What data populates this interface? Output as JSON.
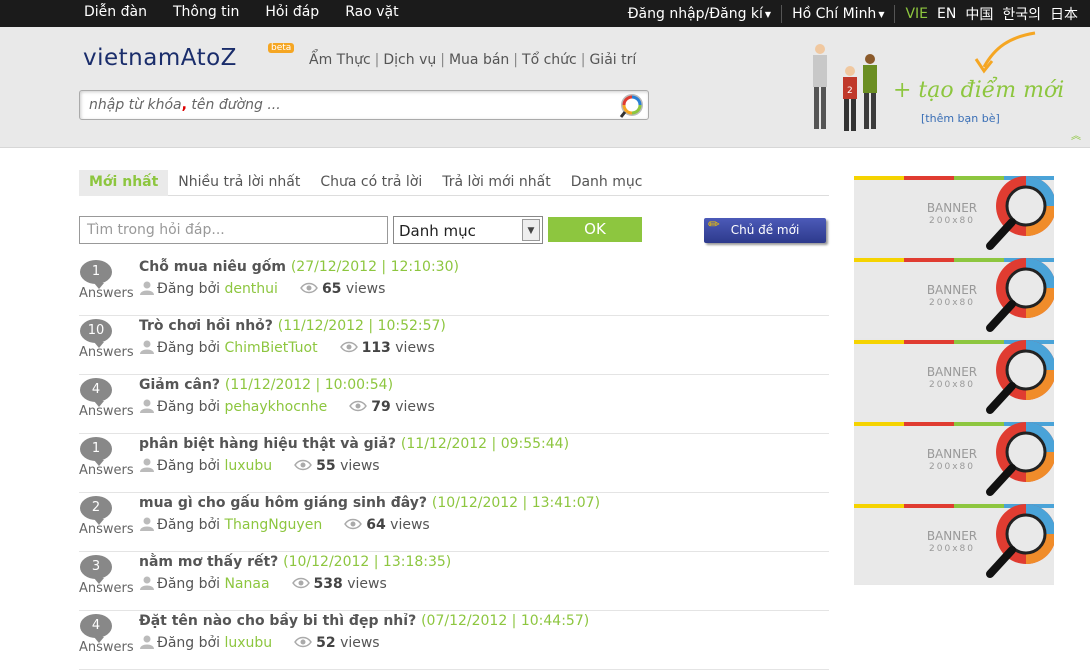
{
  "topbar": {
    "nav": [
      "Diễn đàn",
      "Thông tin",
      "Hỏi đáp",
      "Rao vặt"
    ],
    "login": "Đăng nhập/Đăng kí",
    "city": "Hồ Chí Minh",
    "languages": {
      "active": "VIE",
      "others": [
        "EN",
        "中国",
        "한국의",
        "日本"
      ]
    }
  },
  "header": {
    "logo": "vietnamAtoZ",
    "logo_badge": "beta",
    "categories": [
      "Ẩm Thực",
      "Dịch vụ",
      "Mua bán",
      "Tổ chức",
      "Giải trí"
    ],
    "search_placeholder_a": "nhập từ khóa",
    "search_placeholder_comma": ",",
    "search_placeholder_b": " tên đường ...",
    "add_place": "+ tạo điểm mới",
    "add_friend": "[thêm bạn bè]"
  },
  "tabs": [
    "Mới nhất",
    "Nhiều trả lời nhất",
    "Chưa có trả lời",
    "Trả lời mới nhất",
    "Danh mục"
  ],
  "filter": {
    "search_placeholder": "Tìm trong hỏi đáp...",
    "category_select": "Danh mục",
    "ok_label": "OK",
    "new_topic_label": "Chủ đề mới"
  },
  "questions": [
    {
      "answers": "1",
      "answers_label": "Answers",
      "title": "Chỗ mua niêu gốm",
      "date": "(27/12/2012 | 12:10:30)",
      "posted_by": "Đăng bởi",
      "author": "denthui",
      "views": "65",
      "views_label": "views"
    },
    {
      "answers": "10",
      "answers_label": "Answers",
      "title": "Trò chơi hồi nhỏ?",
      "date": "(11/12/2012 | 10:52:57)",
      "posted_by": "Đăng bởi",
      "author": "ChimBietTuot",
      "views": "113",
      "views_label": "views"
    },
    {
      "answers": "4",
      "answers_label": "Answers",
      "title": "Giảm cân?",
      "date": "(11/12/2012 | 10:00:54)",
      "posted_by": "Đăng bởi",
      "author": "pehaykhocnhe",
      "views": "79",
      "views_label": "views"
    },
    {
      "answers": "1",
      "answers_label": "Answers",
      "title": "phân biệt hàng hiệu thật và giả?",
      "date": "(11/12/2012 | 09:55:44)",
      "posted_by": "Đăng bởi",
      "author": "luxubu",
      "views": "55",
      "views_label": "views"
    },
    {
      "answers": "2",
      "answers_label": "Answers",
      "title": "mua gì cho gấu hôm giáng sinh đây?",
      "date": "(10/12/2012 | 13:41:07)",
      "posted_by": "Đăng bởi",
      "author": "ThangNguyen",
      "views": "64",
      "views_label": "views"
    },
    {
      "answers": "3",
      "answers_label": "Answers",
      "title": "nằm mơ thấy rết?",
      "date": "(10/12/2012 | 13:18:35)",
      "posted_by": "Đăng bởi",
      "author": "Nanaa",
      "views": "538",
      "views_label": "views"
    },
    {
      "answers": "4",
      "answers_label": "Answers",
      "title": "Đặt tên nào cho bầy bi thì đẹp nhỉ?",
      "date": "(07/12/2012 | 10:44:57)",
      "posted_by": "Đăng bởi",
      "author": "luxubu",
      "views": "52",
      "views_label": "views"
    }
  ],
  "banners": [
    {
      "label": "BANNER",
      "size": "200x80"
    },
    {
      "label": "BANNER",
      "size": "200x80"
    },
    {
      "label": "BANNER",
      "size": "200x80"
    },
    {
      "label": "BANNER",
      "size": "200x80"
    },
    {
      "label": "BANNER",
      "size": "200x80"
    }
  ],
  "colors": {
    "accent": "#8dc63f",
    "topbar": "#1b1b1b",
    "logo": "#1a2d6b",
    "button_blue": "#2d3a8c"
  }
}
